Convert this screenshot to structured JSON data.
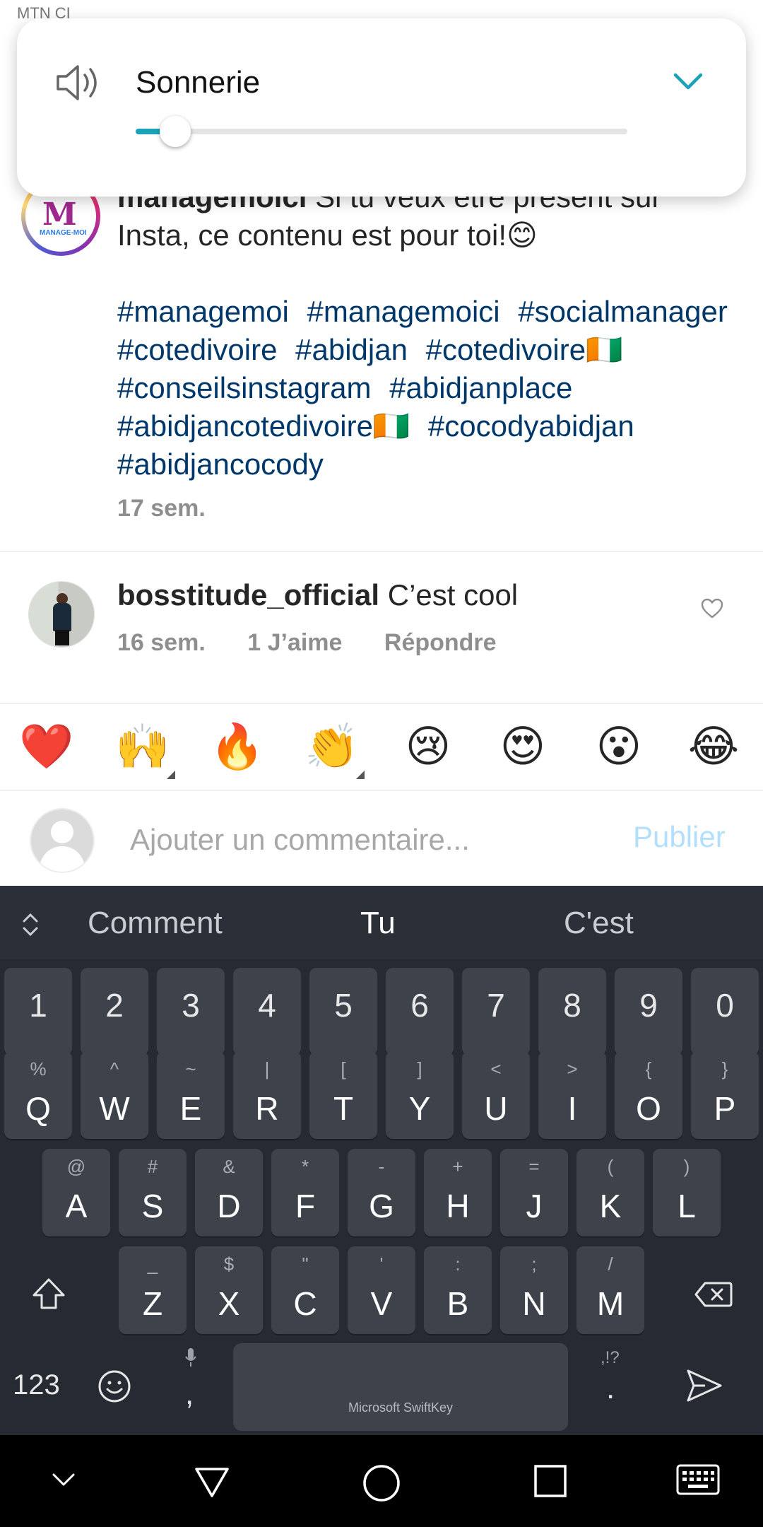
{
  "status_bar": {
    "carrier": "MTN CI"
  },
  "volume_panel": {
    "label": "Sonnerie",
    "level_percent": 8,
    "accent": "#1aa3b8"
  },
  "post": {
    "username": "managemoici",
    "caption": "Si tu veux être présent sur Insta, ce contenu est pour toi!😊",
    "avatar_text": "M",
    "avatar_subtext": "MANAGE-MOI",
    "hashtags": [
      "#managemoi",
      "#managemoici",
      "#socialmanager",
      "#cotedivoire",
      "#abidjan",
      "#cotedivoire🇨🇮",
      "#conseilsinstagram",
      "#abidjanplace",
      "#abidjancotedivoire🇨🇮",
      "#cocodyabidjan",
      "#abidjancocody"
    ],
    "time": "17 sem."
  },
  "comment": {
    "username": "bosstitude_official",
    "text": "C’est cool",
    "time": "16 sem.",
    "likes": "1 J’aime",
    "reply": "Répondre"
  },
  "emoji_bar": [
    "❤️",
    "🙌",
    "🔥",
    "👏",
    "😢",
    "😍",
    "😮",
    "😂"
  ],
  "comment_input": {
    "placeholder": "Ajouter un commentaire...",
    "publish_label": "Publier"
  },
  "keyboard": {
    "name": "Microsoft SwiftKey",
    "suggestions": [
      "Comment",
      "Tu",
      "C'est"
    ],
    "numbers": [
      "1",
      "2",
      "3",
      "4",
      "5",
      "6",
      "7",
      "8",
      "9",
      "0"
    ],
    "row1": [
      {
        "k": "Q",
        "s": "%"
      },
      {
        "k": "W",
        "s": "^"
      },
      {
        "k": "E",
        "s": "~"
      },
      {
        "k": "R",
        "s": "|"
      },
      {
        "k": "T",
        "s": "["
      },
      {
        "k": "Y",
        "s": "]"
      },
      {
        "k": "U",
        "s": "<"
      },
      {
        "k": "I",
        "s": ">"
      },
      {
        "k": "O",
        "s": "{"
      },
      {
        "k": "P",
        "s": "}"
      }
    ],
    "row2": [
      {
        "k": "A",
        "s": "@"
      },
      {
        "k": "S",
        "s": "#"
      },
      {
        "k": "D",
        "s": "&"
      },
      {
        "k": "F",
        "s": "*"
      },
      {
        "k": "G",
        "s": "-"
      },
      {
        "k": "H",
        "s": "+"
      },
      {
        "k": "J",
        "s": "="
      },
      {
        "k": "K",
        "s": "("
      },
      {
        "k": "L",
        "s": ")"
      }
    ],
    "row3": [
      {
        "k": "Z",
        "s": "_"
      },
      {
        "k": "X",
        "s": "$"
      },
      {
        "k": "C",
        "s": "\""
      },
      {
        "k": "V",
        "s": "'"
      },
      {
        "k": "B",
        "s": ":"
      },
      {
        "k": "N",
        "s": ";"
      },
      {
        "k": "M",
        "s": "/"
      }
    ],
    "numbers_key": "123",
    "comma_key": ",",
    "period_key": ".",
    "period_sub": ",!?"
  }
}
